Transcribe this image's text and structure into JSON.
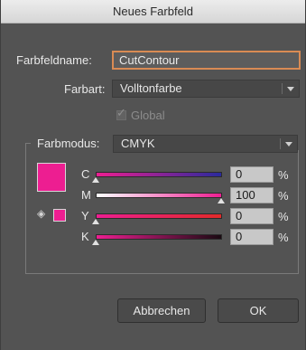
{
  "window": {
    "title": "Neues Farbfeld"
  },
  "form": {
    "name_label": "Farbfeldname:",
    "name_value": "CutContour",
    "type_label": "Farbart:",
    "type_value": "Volltonfarbe",
    "global_label": "Global",
    "global_checked": true,
    "global_enabled": false,
    "mode_label": "Farbmodus:",
    "mode_value": "CMYK"
  },
  "channels": [
    {
      "label": "C",
      "value": "0",
      "unit": "%",
      "gradient_from": "#ed1e91",
      "gradient_to": "#2a2a9c"
    },
    {
      "label": "M",
      "value": "100",
      "unit": "%",
      "gradient_from": "#ffffff",
      "gradient_to": "#ed1e91"
    },
    {
      "label": "Y",
      "value": "0",
      "unit": "%",
      "gradient_from": "#ed1e91",
      "gradient_to": "#e22a2a"
    },
    {
      "label": "K",
      "value": "0",
      "unit": "%",
      "gradient_from": "#ed1e91",
      "gradient_to": "#1a0a12"
    }
  ],
  "swatch_color": "#ed1e91",
  "buttons": {
    "cancel": "Abbrechen",
    "ok": "OK"
  },
  "icons": {
    "gamut": "cube-icon",
    "dropdown": "chevron-down-icon",
    "check": "checkmark-icon"
  }
}
